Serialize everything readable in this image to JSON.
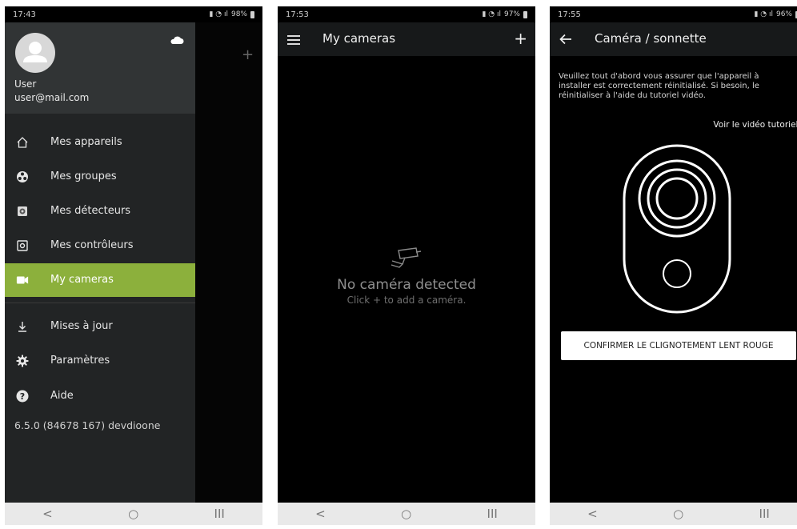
{
  "screen1": {
    "status_time": "17:43",
    "battery": "98%",
    "user_name": "User",
    "user_email": "user@mail.com",
    "background_plus": "+",
    "menu": [
      {
        "label": "Mes appareils",
        "icon": "home-icon"
      },
      {
        "label": "Mes groupes",
        "icon": "groups-icon"
      },
      {
        "label": "Mes détecteurs",
        "icon": "detector-icon"
      },
      {
        "label": "Mes contrôleurs",
        "icon": "controller-icon"
      },
      {
        "label": "My cameras",
        "icon": "camera-icon",
        "active": true
      },
      {
        "label": "Mises à jour",
        "icon": "download-icon"
      },
      {
        "label": "Paramètres",
        "icon": "gear-icon"
      },
      {
        "label": "Aide",
        "icon": "help-icon"
      }
    ],
    "version": "6.5.0 (84678 167) devdioone"
  },
  "screen2": {
    "status_time": "17:53",
    "battery": "97%",
    "title": "My cameras",
    "add_label": "+",
    "empty_title": "No caméra detected",
    "empty_subtitle": "Click + to add a caméra."
  },
  "screen3": {
    "status_time": "17:55",
    "battery": "96%",
    "title": "Caméra / sonnette",
    "instructions": "Veuillez tout d'abord vous assurer que l'appareil à installer est correctement réinitialisé. Si besoin, le réinitialiser à l'aide du tutoriel vidéo.",
    "tutorial_link": "Voir le vidéo tutoriel",
    "confirm_button": "CONFIRMER LE CLIGNOTEMENT LENT ROUGE"
  },
  "nav": {
    "back": "<",
    "home": "○",
    "recents": "III"
  },
  "colors": {
    "accent": "#8cb03c",
    "drawer": "#222425",
    "appbar": "#17191a"
  }
}
